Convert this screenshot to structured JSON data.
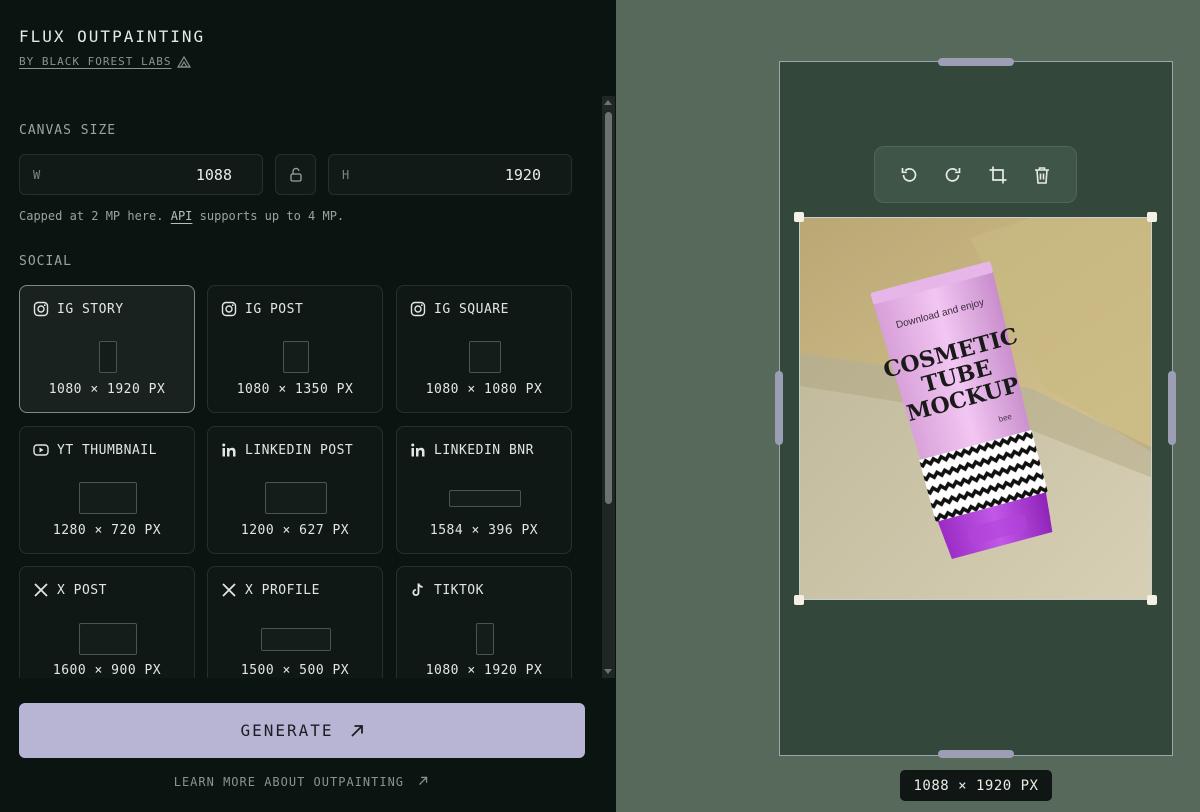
{
  "brand": {
    "title": "FLUX OUTPAINTING",
    "subtitle": "BY BLACK FOREST LABS"
  },
  "canvas": {
    "section_label": "CANVAS SIZE",
    "width_label": "W",
    "width_value": "1088",
    "height_label": "H",
    "height_value": "1920",
    "hint_prefix": "Capped at 2 MP here.",
    "hint_link": "API",
    "hint_suffix": "supports up to 4 MP."
  },
  "social": {
    "section_label": "SOCIAL",
    "presets": [
      {
        "label": "IG STORY",
        "dims": "1080 × 1920 PX",
        "icon": "instagram-icon",
        "selected": true
      },
      {
        "label": "IG POST",
        "dims": "1080 × 1350 PX",
        "icon": "instagram-icon"
      },
      {
        "label": "IG SQUARE",
        "dims": "1080 × 1080 PX",
        "icon": "instagram-icon"
      },
      {
        "label": "YT THUMBNAIL",
        "dims": "1280 × 720 PX",
        "icon": "youtube-icon"
      },
      {
        "label": "LINKEDIN POST",
        "dims": "1200 × 627 PX",
        "icon": "linkedin-icon"
      },
      {
        "label": "LINKEDIN BNR",
        "dims": "1584 × 396 PX",
        "icon": "linkedin-icon"
      },
      {
        "label": "X POST",
        "dims": "1600 × 900 PX",
        "icon": "x-icon"
      },
      {
        "label": "X PROFILE",
        "dims": "1500 × 500 PX",
        "icon": "x-icon"
      },
      {
        "label": "TIKTOK",
        "dims": "1080 × 1920 PX",
        "icon": "tiktok-icon"
      }
    ]
  },
  "actions": {
    "generate": "GENERATE",
    "learn_more": "LEARN MORE ABOUT OUTPAINTING"
  },
  "preview": {
    "size_badge": "1088 × 1920 PX",
    "tube_text": {
      "tagline": "Download and enjoy",
      "line1": "COSMETIC",
      "line2": "TUBE",
      "line3": "MOCKUP",
      "badge": "bee"
    },
    "tools": [
      "undo-icon",
      "redo-icon",
      "crop-icon",
      "trash-icon"
    ]
  },
  "colors": {
    "accent": "#b8b4d4",
    "workspace": "#56695a",
    "canvas": "#34473b",
    "sidebar": "#0a1411"
  }
}
